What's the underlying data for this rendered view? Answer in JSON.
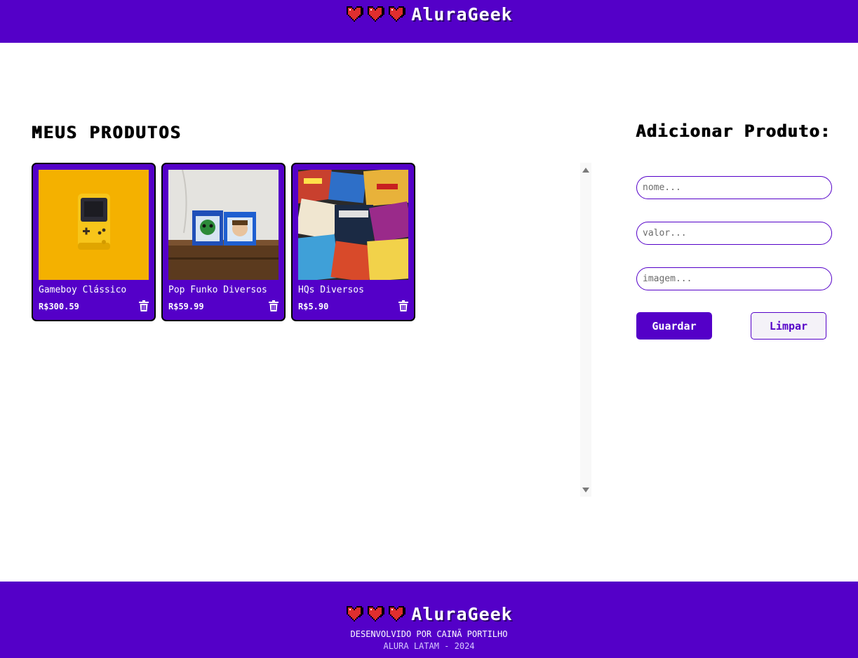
{
  "brand": {
    "name": "AluraGeek",
    "primary_color": "#5400c8",
    "heart_color": "#e02e2e"
  },
  "products_section": {
    "title": "MEUS PRODUTOS"
  },
  "products": [
    {
      "name": "Gameboy Clássico",
      "price": "R$300.59",
      "image": "yellow-gameboy-photo",
      "delete_icon": "trash-icon"
    },
    {
      "name": "Pop Funko Diversos",
      "price": "R$59.99",
      "image": "funko-pop-boxes-photo",
      "delete_icon": "trash-icon"
    },
    {
      "name": "HQs Diversos",
      "price": "R$5.90",
      "image": "comic-books-collage-photo",
      "delete_icon": "trash-icon"
    }
  ],
  "form": {
    "title": "Adicionar Produto:",
    "name_placeholder": "nome...",
    "value_placeholder": "valor...",
    "image_placeholder": "imagem...",
    "save_label": "Guardar",
    "clear_label": "Limpar"
  },
  "footer": {
    "credit": "DESENVOLVIDO POR CAINÃ PORTILHO",
    "org": "ALURA LATAM - 2024"
  }
}
